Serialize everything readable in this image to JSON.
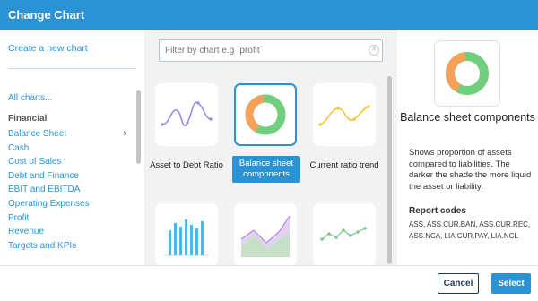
{
  "dialog": {
    "title": "Change Chart"
  },
  "sidebar": {
    "create_link": "Create a new chart",
    "all_charts": "All charts...",
    "section": "Financial",
    "items": [
      {
        "label": "Balance Sheet",
        "active": true
      },
      {
        "label": "Cash"
      },
      {
        "label": "Cost of Sales"
      },
      {
        "label": "Debt and Finance"
      },
      {
        "label": "EBIT and EBITDA"
      },
      {
        "label": "Operating Expenses"
      },
      {
        "label": "Profit"
      },
      {
        "label": "Revenue"
      },
      {
        "label": "Targets and KPIs"
      }
    ]
  },
  "gallery": {
    "filter_placeholder": "Filter by chart e.g `profit`",
    "cards": [
      {
        "label": "Asset to Debt Ratio",
        "icon": "line-chart-icon"
      },
      {
        "label": "Balance sheet components",
        "icon": "donut-chart-icon",
        "selected": true
      },
      {
        "label": "Current ratio trend",
        "icon": "curve-chart-icon"
      },
      {
        "label": "",
        "icon": "bar-chart-icon"
      },
      {
        "label": "",
        "icon": "area-chart-icon"
      },
      {
        "label": "",
        "icon": "dot-line-chart-icon"
      }
    ]
  },
  "details": {
    "title": "Balance sheet components",
    "description": "Shows proportion of assets compared to liabilities. The darker the shade the more liquid the asset or liability.",
    "report_codes_title": "Report codes",
    "report_codes": "ASS, ASS.CUR.BAN, ASS.CUR.REC, ASS.NCA, LIA.CUR.PAY, LIA.NCL",
    "donut_colors": {
      "orange": "#f4a25a",
      "green": "#6fcf7d"
    }
  },
  "footer": {
    "cancel_label": "Cancel",
    "select_label": "Select"
  },
  "colors": {
    "accent": "#2a93d5",
    "navy": "#1d3b57"
  }
}
